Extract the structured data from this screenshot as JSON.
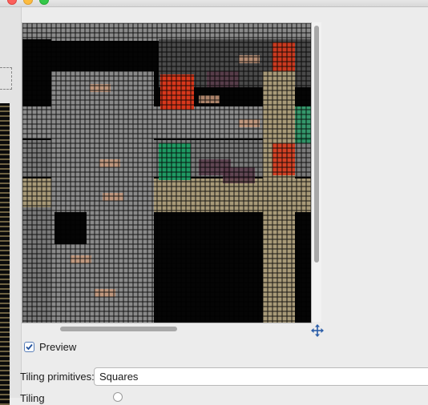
{
  "window": {
    "buttons": {
      "close": "close-button",
      "minimize": "minimize-button",
      "zoom": "zoom-button"
    }
  },
  "preview": {
    "checkbox_label": "Preview",
    "checked": true,
    "icon": "move-icon"
  },
  "settings": {
    "tiling_label": "Tiling primitives:",
    "tiling_value": "Squares",
    "next_label_partial": "Tiling"
  },
  "colors": {
    "accent": "#2c5ea8",
    "tile_gray": "#8f8f8f",
    "tile_tan": "#a89a78",
    "tile_red": "#d8381c",
    "tile_green": "#1f9a63"
  }
}
